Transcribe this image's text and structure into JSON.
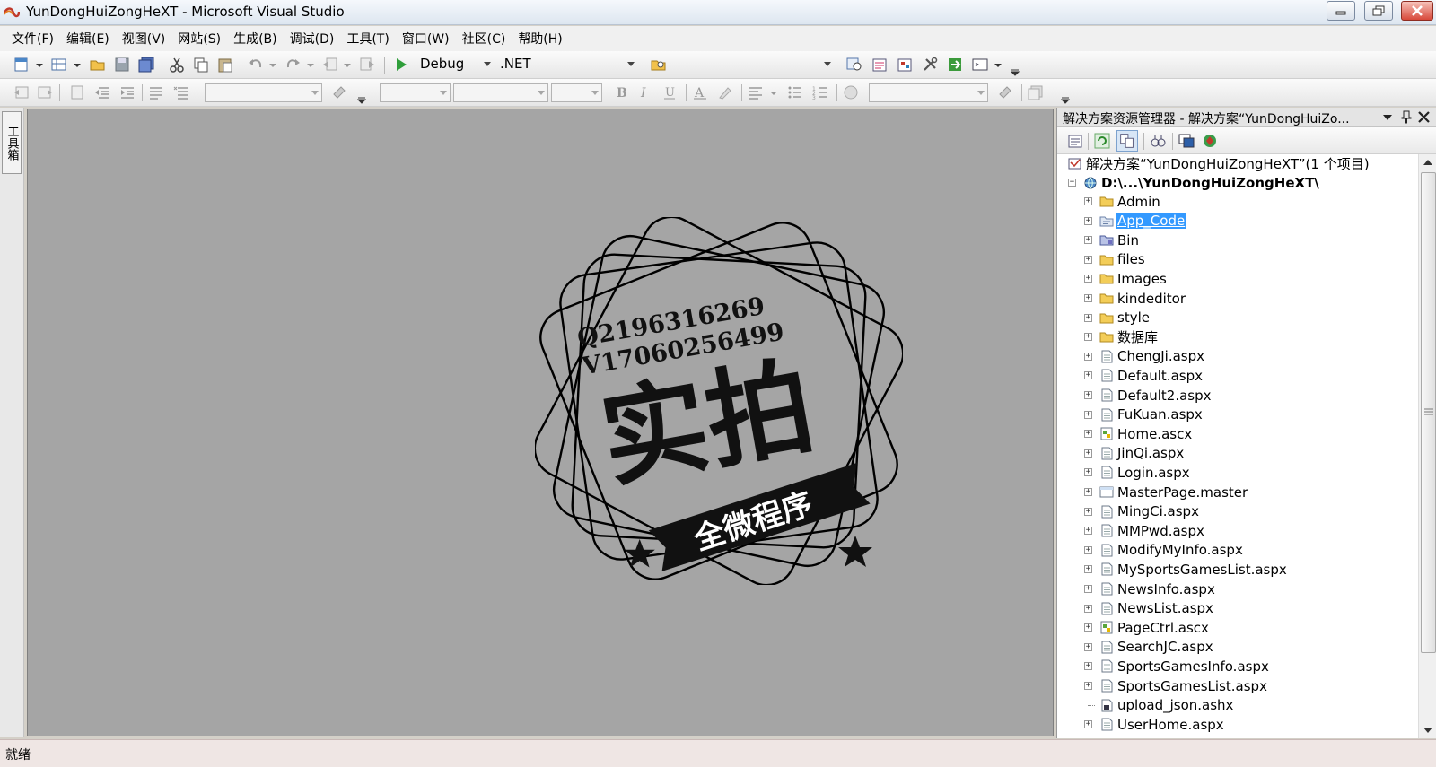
{
  "window": {
    "title": "YunDongHuiZongHeXT - Microsoft Visual Studio"
  },
  "menu": {
    "items": [
      {
        "label": "文件(F)"
      },
      {
        "label": "编辑(E)"
      },
      {
        "label": "视图(V)"
      },
      {
        "label": "网站(S)"
      },
      {
        "label": "生成(B)"
      },
      {
        "label": "调试(D)"
      },
      {
        "label": "工具(T)"
      },
      {
        "label": "窗口(W)"
      },
      {
        "label": "社区(C)"
      },
      {
        "label": "帮助(H)"
      }
    ]
  },
  "toolbar": {
    "configuration": "Debug",
    "platform": ".NET"
  },
  "toolbox": {
    "tab_label": "工具箱"
  },
  "watermark": {
    "line1": "Q2196316269",
    "line2": "V17060256499",
    "main_text": "实拍",
    "banner_text": "全微程序"
  },
  "solution_explorer": {
    "title": "解决方案资源管理器 - 解决方案“YunDongHuiZo...",
    "solution_label": "解决方案“YunDongHuiZongHeXT”(1 个项目)",
    "project_label": "D:\\...\\YunDongHuiZongHeXT\\",
    "items": [
      {
        "label": "Admin",
        "icon": "folder-icon"
      },
      {
        "label": "App_Code",
        "icon": "code-folder-icon",
        "selected": true
      },
      {
        "label": "Bin",
        "icon": "bin-folder-icon"
      },
      {
        "label": "files",
        "icon": "folder-icon"
      },
      {
        "label": "Images",
        "icon": "folder-icon"
      },
      {
        "label": "kindeditor",
        "icon": "folder-icon"
      },
      {
        "label": "style",
        "icon": "folder-icon"
      },
      {
        "label": "数据库",
        "icon": "folder-icon"
      },
      {
        "label": "ChengJi.aspx",
        "icon": "aspx-file-icon"
      },
      {
        "label": "Default.aspx",
        "icon": "aspx-file-icon"
      },
      {
        "label": "Default2.aspx",
        "icon": "aspx-file-icon"
      },
      {
        "label": "FuKuan.aspx",
        "icon": "aspx-file-icon"
      },
      {
        "label": "Home.ascx",
        "icon": "ascx-file-icon"
      },
      {
        "label": "JinQi.aspx",
        "icon": "aspx-file-icon"
      },
      {
        "label": "Login.aspx",
        "icon": "aspx-file-icon"
      },
      {
        "label": "MasterPage.master",
        "icon": "master-file-icon"
      },
      {
        "label": "MingCi.aspx",
        "icon": "aspx-file-icon"
      },
      {
        "label": "MMPwd.aspx",
        "icon": "aspx-file-icon"
      },
      {
        "label": "ModifyMyInfo.aspx",
        "icon": "aspx-file-icon"
      },
      {
        "label": "MySportsGamesList.aspx",
        "icon": "aspx-file-icon"
      },
      {
        "label": "NewsInfo.aspx",
        "icon": "aspx-file-icon"
      },
      {
        "label": "NewsList.aspx",
        "icon": "aspx-file-icon"
      },
      {
        "label": "PageCtrl.ascx",
        "icon": "ascx-file-icon"
      },
      {
        "label": "SearchJC.aspx",
        "icon": "aspx-file-icon"
      },
      {
        "label": "SportsGamesInfo.aspx",
        "icon": "aspx-file-icon"
      },
      {
        "label": "SportsGamesList.aspx",
        "icon": "aspx-file-icon"
      },
      {
        "label": "upload_json.ashx",
        "icon": "ashx-file-icon",
        "no_expander": true
      },
      {
        "label": "UserHome.aspx",
        "icon": "aspx-file-icon"
      }
    ]
  },
  "status": {
    "text": "就绪"
  }
}
